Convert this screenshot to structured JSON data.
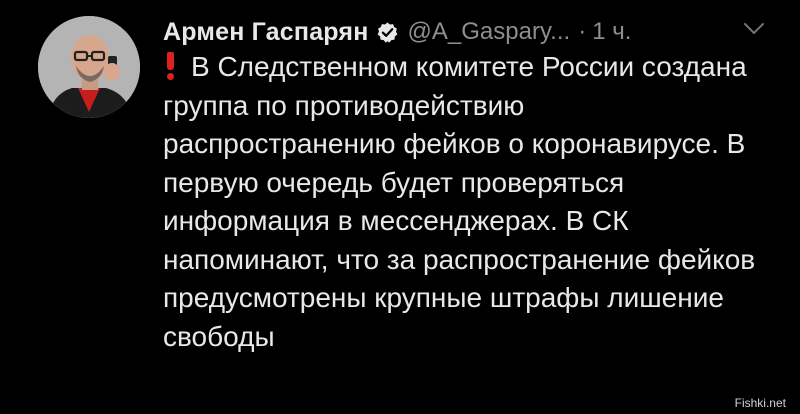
{
  "author": {
    "name": "Армен Гаспарян",
    "handle": "@A_Gaspary...",
    "separator": "·",
    "time": "1 ч."
  },
  "tweet": {
    "text": "В Следственном комитете России создана группа по противодействию распространению фейков о коронавирусе. В первую очередь будет проверяться информация в мессенджерах. В СК напоминают, что за распространение фейков предусмотрены крупные штрафы лишение свободы"
  },
  "icons": {
    "verified": "verified-badge-icon",
    "menu": "chevron-down-icon",
    "exclamation": "red-exclamation-icon"
  },
  "colors": {
    "background": "#000000",
    "text": "#e8e8e8",
    "muted": "#8a8f94",
    "exclamation": "#e0201f"
  },
  "watermark": "Fishki.net"
}
